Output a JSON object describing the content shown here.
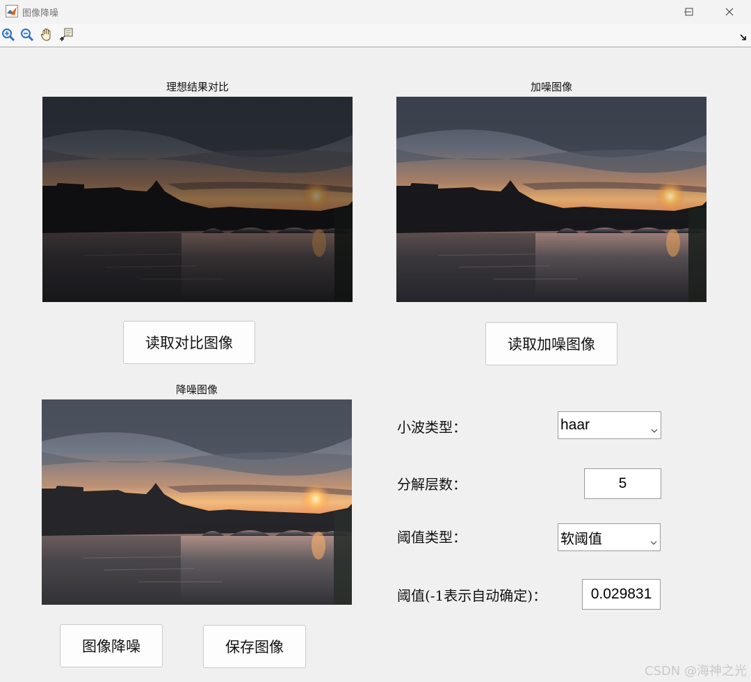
{
  "window": {
    "title": "图像降噪",
    "controls": {
      "minimize": "—",
      "maximize": "☐",
      "close": "✕"
    }
  },
  "toolbar": {
    "tools": [
      {
        "name": "zoom-in-icon"
      },
      {
        "name": "zoom-out-icon"
      },
      {
        "name": "pan-hand-icon"
      },
      {
        "name": "data-cursor-icon"
      }
    ]
  },
  "panels": {
    "reference": {
      "title": "理想结果对比",
      "button": "读取对比图像"
    },
    "noisy": {
      "title": "加噪图像",
      "button": "读取加噪图像"
    },
    "denoised": {
      "title": "降噪图像"
    }
  },
  "actions": {
    "denoise_button": "图像降噪",
    "save_button": "保存图像"
  },
  "settings": {
    "wavelet_label": "小波类型：",
    "wavelet_value": "haar",
    "levels_label": "分解层数：",
    "levels_value": "5",
    "threshold_type_label": "阈值类型：",
    "threshold_type_value": "软阈值",
    "threshold_label": "阈值(-1表示自动确定)：",
    "threshold_value": "0.029831"
  },
  "watermark": "CSDN @海神之光",
  "colors": {
    "background": "#f0f0f0",
    "sunset": "#f2a25a",
    "sky": "#5d6673"
  }
}
